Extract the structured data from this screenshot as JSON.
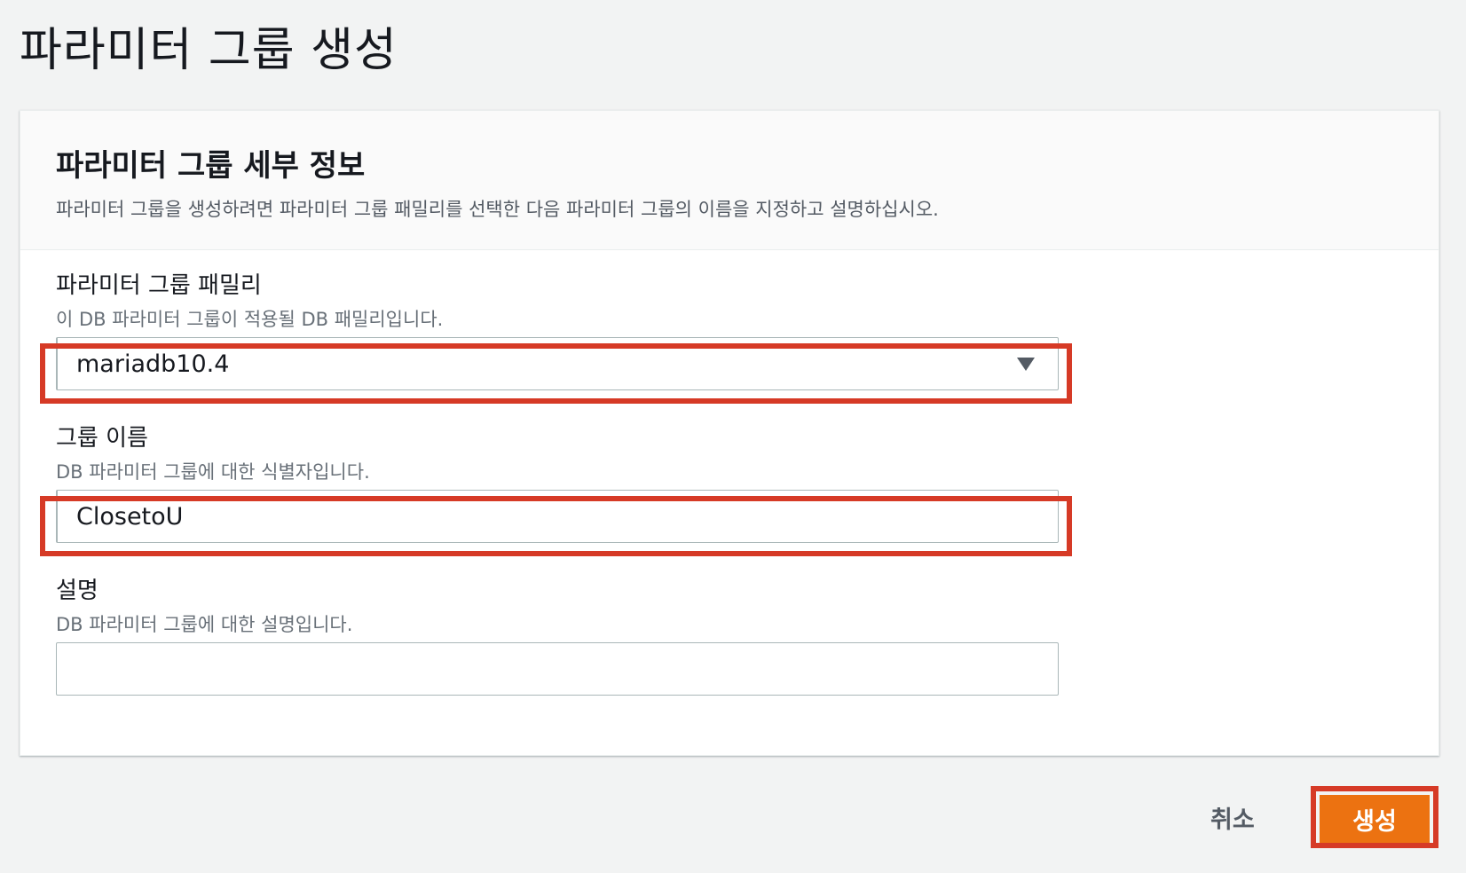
{
  "page_title": "파라미터 그룹 생성",
  "panel": {
    "title": "파라미터 그룹 세부 정보",
    "description": "파라미터 그룹을 생성하려면 파라미터 그룹 패밀리를 선택한 다음 파라미터 그룹의 이름을 지정하고 설명하십시오."
  },
  "fields": {
    "family": {
      "label": "파라미터 그룹 패밀리",
      "help": "이 DB 파라미터 그룹이 적용될 DB 패밀리입니다.",
      "value": "mariadb10.4"
    },
    "group_name": {
      "label": "그룹 이름",
      "help": "DB 파라미터 그룹에 대한 식별자입니다.",
      "value": "ClosetoU"
    },
    "description": {
      "label": "설명",
      "help": "DB 파라미터 그룹에 대한 설명입니다.",
      "value": ""
    }
  },
  "actions": {
    "cancel_label": "취소",
    "create_label": "생성"
  },
  "colors": {
    "primary_button": "#ec7211",
    "highlight_box": "#d63a26",
    "background": "#f2f3f3"
  },
  "icons": {
    "select_caret": "caret-down-icon"
  }
}
